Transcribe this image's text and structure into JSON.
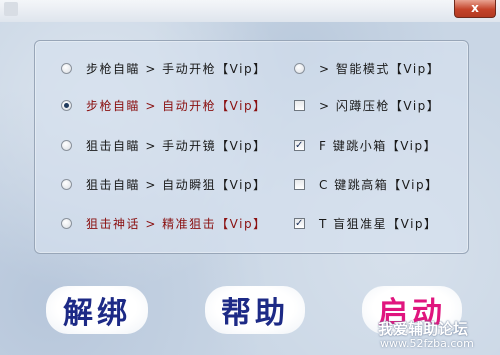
{
  "window": {
    "close_glyph": "x"
  },
  "options_left": [
    {
      "label": "步枪自瞄 > 手动开枪【Vip】",
      "checked": false,
      "color": "#1a1a1a"
    },
    {
      "label": "步枪自瞄 > 自动开枪【Vip】",
      "checked": true,
      "color": "#8a1010"
    },
    {
      "label": "狙击自瞄 > 手动开镜【Vip】",
      "checked": false,
      "color": "#1a1a1a"
    },
    {
      "label": "狙击自瞄 > 自动瞬狙【Vip】",
      "checked": false,
      "color": "#1a1a1a"
    },
    {
      "label": "狙击神话 > 精准狙击【Vip】",
      "checked": false,
      "color": "#8a1010"
    }
  ],
  "options_right": [
    {
      "label": "> 智能模式【Vip】",
      "control": "radio",
      "checked": false
    },
    {
      "label": "> 闪蹲压枪【Vip】",
      "control": "checkbox",
      "checked": false
    },
    {
      "label": "F 键跳小箱【Vip】",
      "control": "checkbox",
      "checked": true
    },
    {
      "label": "C 键跳高箱【Vip】",
      "control": "checkbox",
      "checked": false
    },
    {
      "label": "T 盲狙准星【Vip】",
      "control": "checkbox",
      "checked": true
    }
  ],
  "buttons": {
    "unbind": "解绑",
    "help": "帮助",
    "start": "启动"
  },
  "watermark": {
    "text": "我爱辅助论坛",
    "url": "www.52fzba.com"
  },
  "colors": {
    "primary_text": "#1a1a1a",
    "highlight_text": "#8a1010",
    "button_blue": "#1d2a86",
    "button_pink": "#e0157e"
  }
}
